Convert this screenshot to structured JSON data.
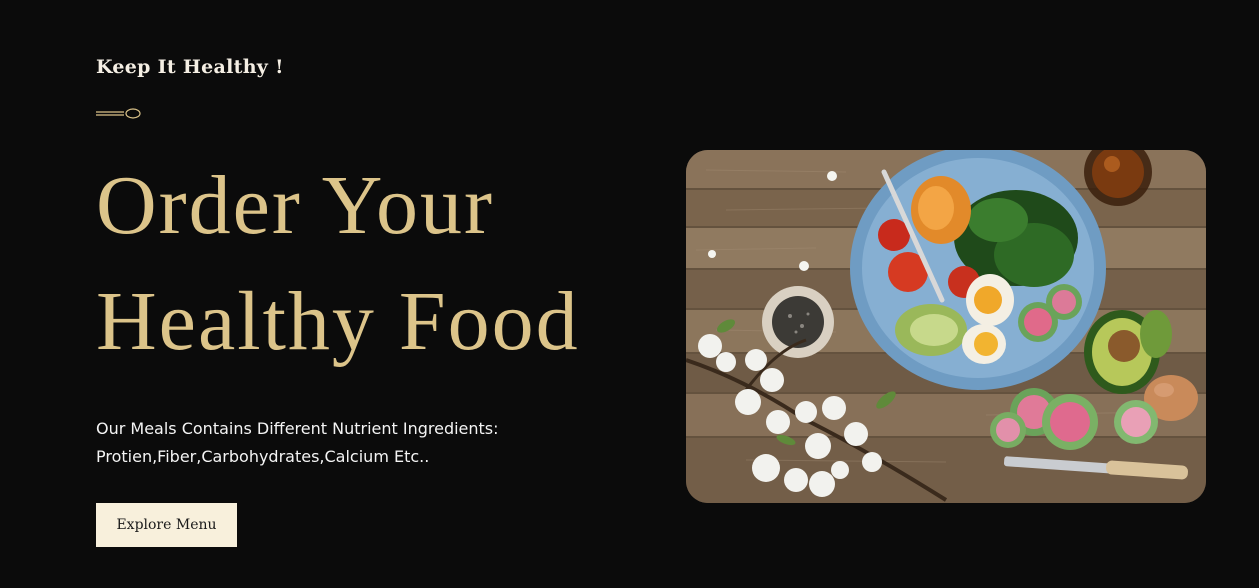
{
  "hero": {
    "kicker": "Keep It Healthy !",
    "divider_icon": "spoon-icon",
    "headline_line1": "Order Your",
    "headline_line2": "Healthy Food",
    "description_line1": "Our Meals Contains Different Nutrient Ingredients:",
    "description_line2": "Protien,Fiber,Carbohydrates,Calcium Etc..",
    "cta_label": "Explore Menu",
    "image_subject": "healthy-salad-bowl"
  },
  "colors": {
    "background": "#0b0b0b",
    "accent_gold": "#dcc48a",
    "button_bg": "#f8f0dc",
    "text_light": "#f4f4f4"
  }
}
